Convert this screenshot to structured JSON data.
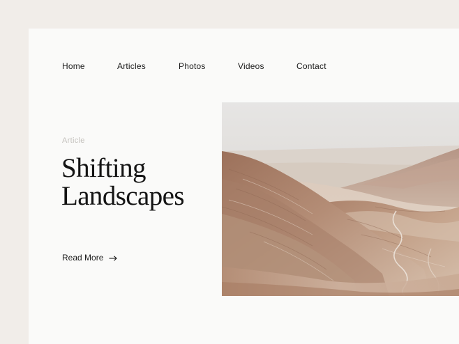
{
  "nav": {
    "items": [
      "Home",
      "Articles",
      "Photos",
      "Videos",
      "Contact"
    ]
  },
  "article": {
    "eyebrow": "Article",
    "title_line1": "Shifting",
    "title_line2": "Landscapes",
    "cta_label": "Read More"
  },
  "icons": {
    "cta": "arrow-right-icon"
  },
  "colors": {
    "page_background": "#f1ede9",
    "card_background": "#fafaf9",
    "text": "#1b1b1b",
    "eyebrow": "#c3c0bc",
    "sand": "#b8927a"
  },
  "hero_image": {
    "subject": "desert-hills-photo"
  }
}
